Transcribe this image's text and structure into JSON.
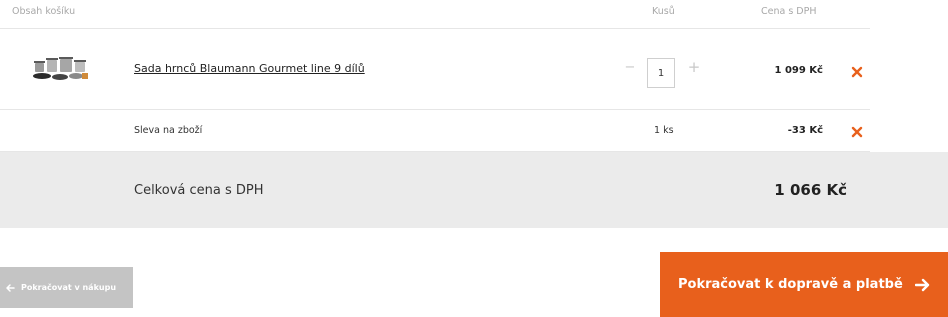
{
  "cart_header": {
    "col_contents": "Obsah košíku",
    "col_quantity": "Kusů",
    "col_price": "Cena s DPH"
  },
  "items": [
    {
      "name": "Sada hrnců Blaumann Gourmet line 9 dílů",
      "quantity": "1",
      "price": "1 099 Kč"
    }
  ],
  "discount": {
    "label": "Sleva na zboží",
    "quantity": "1 ks",
    "price": "-33 Kč"
  },
  "total": {
    "label": "Celková cena s DPH",
    "value": "1 066 Kč"
  },
  "actions": {
    "back_label": "Pokračovat v nákupu",
    "next_label": "Pokračovat k dopravě a platbě"
  },
  "icons": {
    "qty_minus": "−",
    "qty_plus": "+",
    "remove": "close-icon",
    "arrow_left": "arrow-left-icon",
    "arrow_right": "arrow-right-icon"
  },
  "colors": {
    "accent": "#e8601c",
    "remove_icon": "#e8601c",
    "back_button": "#c4c4c4",
    "total_bg": "#ebebeb"
  }
}
